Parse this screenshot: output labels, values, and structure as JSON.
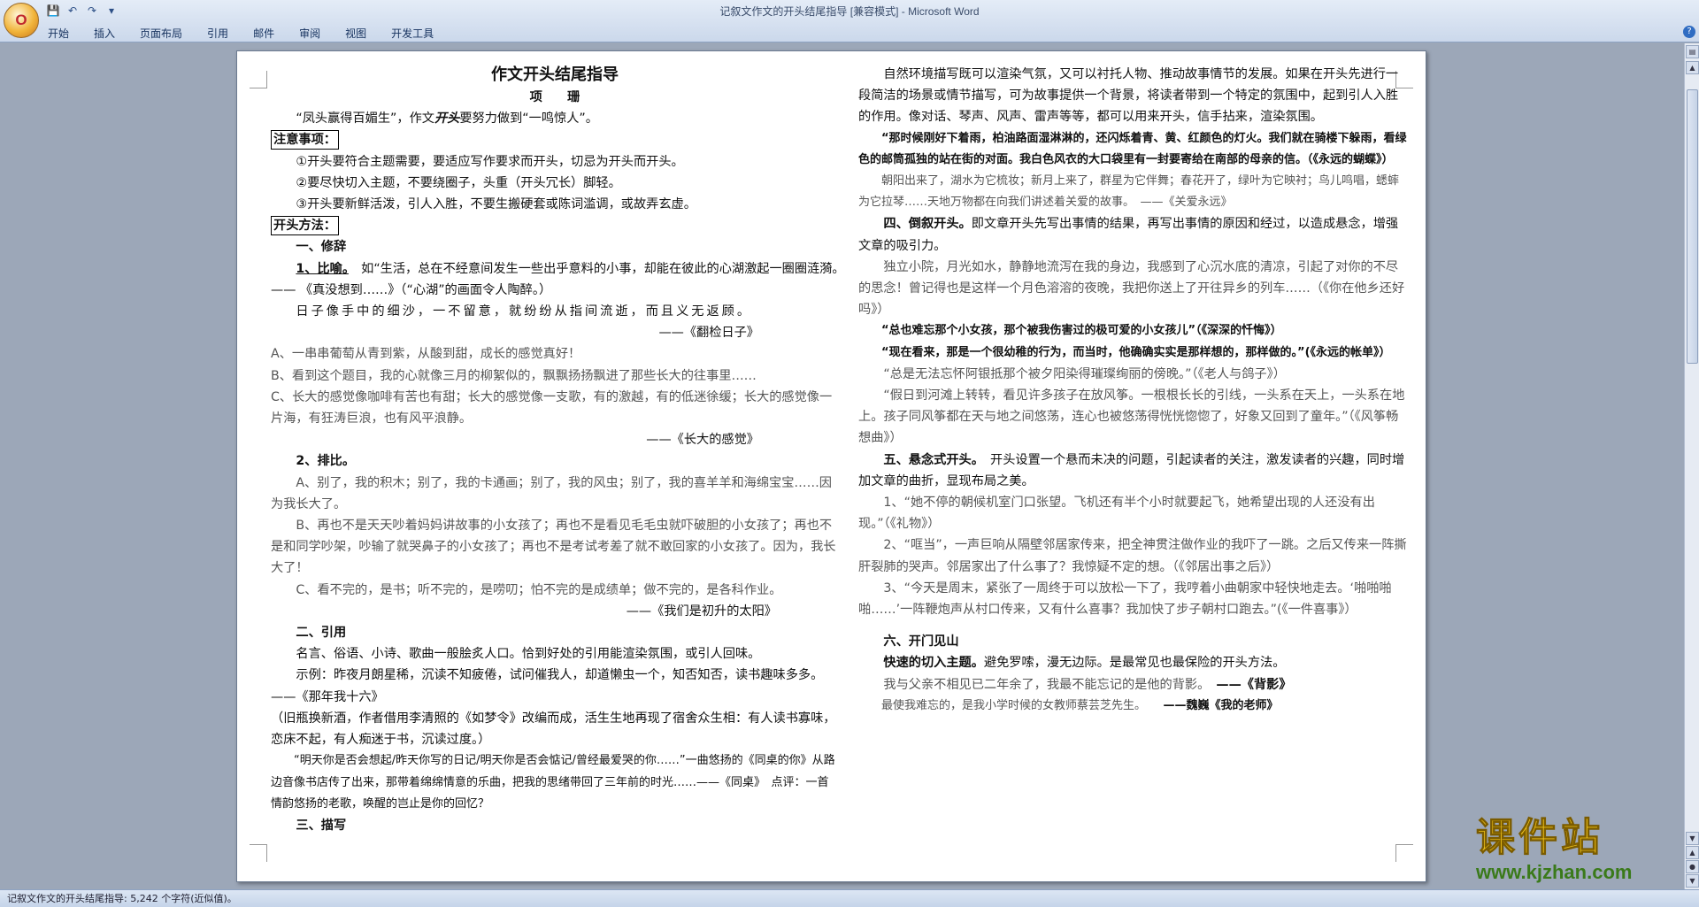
{
  "app": {
    "window_title": "记叙文作文的开头结尾指导 [兼容模式] - Microsoft Word",
    "office_button_label": "O",
    "qat_icons": [
      "save-icon",
      "undo-icon",
      "redo-icon",
      "customize-icon"
    ],
    "tabs": [
      "开始",
      "插入",
      "页面布局",
      "引用",
      "邮件",
      "审阅",
      "视图",
      "开发工具"
    ]
  },
  "status_bar": {
    "text": "记叙文作文的开头结尾指导: 5,242 个字符(近似值)。"
  },
  "watermark": {
    "chinese": "课件站",
    "url": "www.kjzhan.com"
  },
  "doc": {
    "title": "作文开头结尾指导",
    "author": "项　　珊",
    "intro_prefix": "“凤头赢得百媚生”，作文",
    "intro_em": "开头",
    "intro_suffix": "要努力做到“一鸣惊人”。",
    "notice_label": "注意事项：",
    "notices": [
      "①开头要符合主题需要，要适应写作要求而开头，切忌为开头而开头。",
      "②要尽快切入主题，不要绕圈子，头重（开头冗长）脚轻。",
      "③开头要新鲜活泼，引人入胜，不要生搬硬套或陈词滥调，或故弄玄虚。"
    ],
    "methods_label": "开头方法：",
    "s1_title": "一、修辞",
    "s1_1_label": "1、比喻。",
    "s1_1_text": "如“生活，总在不经意间发生一些出乎意料的小事，却能在彼此的心湖激起一圈圈涟漪。　—— 《真没想到……》（“心湖”的画面令人陶醉。）",
    "s1_1_quote": "日子像手中的细沙，一不留意，就纷纷从指间流逝，而且义无返顾。",
    "s1_1_src": "——《翻检日子》",
    "s1_opts": [
      "A、一串串葡萄从青到紫，从酸到甜，成长的感觉真好！",
      "B、看到这个题目，我的心就像三月的柳絮似的，飘飘扬扬飘进了那些长大的往事里……",
      "C、长大的感觉像咖啡有苦也有甜；长大的感觉像一支歌，有的激越，有的低迷徐缓；长大的感觉像一片海，有狂涛巨浪，也有风平浪静。"
    ],
    "s1_opts_src": "——《长大的感觉》",
    "s1_2_label": "2、排比。",
    "s1_2_items": [
      "A、别了，我的积木；别了，我的卡通画；别了，我的风虫；别了，我的喜羊羊和海绵宝宝……因为我长大了。",
      "B、再也不是天天吵着妈妈讲故事的小女孩了；再也不是看见毛毛虫就吓破胆的小女孩了；再也不是和同学吵架，吵输了就哭鼻子的小女孩了；再也不是考试考差了就不敢回家的小女孩了。因为，我长大了！",
      "C、看不完的，是书；听不完的，是唠叨；怕不完的是成绩单；做不完的，是各科作业。"
    ],
    "s1_2_src": "——《我们是初升的太阳》",
    "s2_title": "二、引用",
    "s2_text": "名言、俗语、小诗、歌曲一般脍炙人口。恰到好处的引用能渲染氛围，或引人回味。",
    "s2_example": "示例：昨夜月朗星稀，沉读不知疲倦，试问催我人，却道懒虫一个，知否知否，读书趣味多多。　　——《那年我十六》",
    "s2_note": "（旧瓶换新酒，作者借用李清照的《如梦令》改编而成，活生生地再现了宿舍众生相：有人读书寡味，恋床不起，有人痴迷于书，沉读过度。）",
    "s2_song": "“明天你是否会想起/昨天你写的日记/明天你是否会惦记/曾经最爱哭的你……”一曲悠扬的《同桌的你》从路边音像书店传了出来，那带着绵绵情意的乐曲，把我的思绪带回了三年前的时光……——《同桌》　点评：一首情韵悠扬的老歌，唤醒的岂止是你的回忆？",
    "s3_title": "三、描写",
    "r_desc": "自然环境描写既可以渲染气氛，又可以衬托人物、推动故事情节的发展。如果在开头先进行一段简洁的场景或情节描写，可为故事提供一个背景，将读者带到一个特定的氛围中，起到引人入胜的作用。像对话、琴声、风声、雷声等等，都可以用来开头，信手拈来，渲染氛围。",
    "r_ex1": "“那时候刚好下着雨，柏油路面湿淋淋的，还闪烁着青、黄、红颜色的灯火。我们就在骑楼下躲雨，看绿色的邮筒孤独的站在街的对面。我白色风衣的大口袋里有一封要寄给在南部的母亲的信。（《永远的蝴蝶》）",
    "r_ex2": "朝阳出来了，湖水为它梳妆；新月上来了，群星为它伴舞；春花开了，绿叶为它映衬；鸟儿鸣唱，蟋蟀为它拉琴……天地万物都在向我们讲述着关爱的故事。　——《关爱永远》",
    "r_s4_title": "四、倒叙开头。",
    "r_s4_text": "即文章开头先写出事情的结果，再写出事情的原因和经过，以造成悬念，增强文章的吸引力。",
    "r_s4_ex1": "独立小院，月光如水，静静地流泻在我的身边，我感到了心沉水底的清凉，引起了对你的不尽的思念！曾记得也是这样一个月色溶溶的夜晚，我把你送上了开往异乡的列车……（《你在他乡还好吗》）",
    "r_s4_ex2": "“总也难忘那个小女孩，那个被我伤害过的极可爱的小女孩儿”（《深深的忏悔》）",
    "r_s4_ex3": "“现在看来，那是一个很幼稚的行为，而当时，他确确实实是那样想的，那样做的。”(《永远的帐单》）",
    "r_s4_ex4": "“总是无法忘怀阿银抵那个被夕阳染得璀璨绚丽的傍晚。”（《老人与鸽子》）",
    "r_s4_ex5": "“假日到河滩上转转，看见许多孩子在放风筝。一根根长长的引线，一头系在天上，一头系在地上。孩子同风筝都在天与地之间悠荡，连心也被悠荡得恍恍惚惚了，好象又回到了童年。”（《风筝畅想曲》）",
    "r_s5_title": "五、悬念式开头。",
    "r_s5_text": "开头设置一个悬而未决的问题，引起读者的关注，激发读者的兴趣，同时增加文章的曲折，显现布局之美。",
    "r_s5_items": [
      "1、“她不停的朝候机室门口张望。飞机还有半个小时就要起飞，她希望出现的人还没有出现。”（《礼物》）",
      "2、“哐当”，一声巨响从隔壁邻居家传来，把全神贯注做作业的我吓了一跳。之后又传来一阵撕肝裂肺的哭声。邻居家出了什么事了？我惊疑不定的想。（《邻居出事之后》）",
      "3、“今天是周末，紧张了一周终于可以放松一下了，我哼着小曲朝家中轻快地走去。‘啪啪啪啪……’一阵鞭炮声从村口传来，又有什么喜事？我加快了步子朝村口跑去。”(《一件喜事》）"
    ],
    "r_s6_title": "六、开门见山",
    "r_s6_bold": "快速的切入主题。",
    "r_s6_text": "避免罗嗦，漫无边际。是最常见也最保险的开头方法。",
    "r_s6_ex1_text": "我与父亲不相见已二年余了，我最不能忘记的是他的背影。",
    "r_s6_ex1_src": "——《背影》",
    "r_s6_ex2_text": "最使我难忘的，是我小学时候的女教师蔡芸芝先生。",
    "r_s6_ex2_src": "——魏巍《我的老师》"
  }
}
